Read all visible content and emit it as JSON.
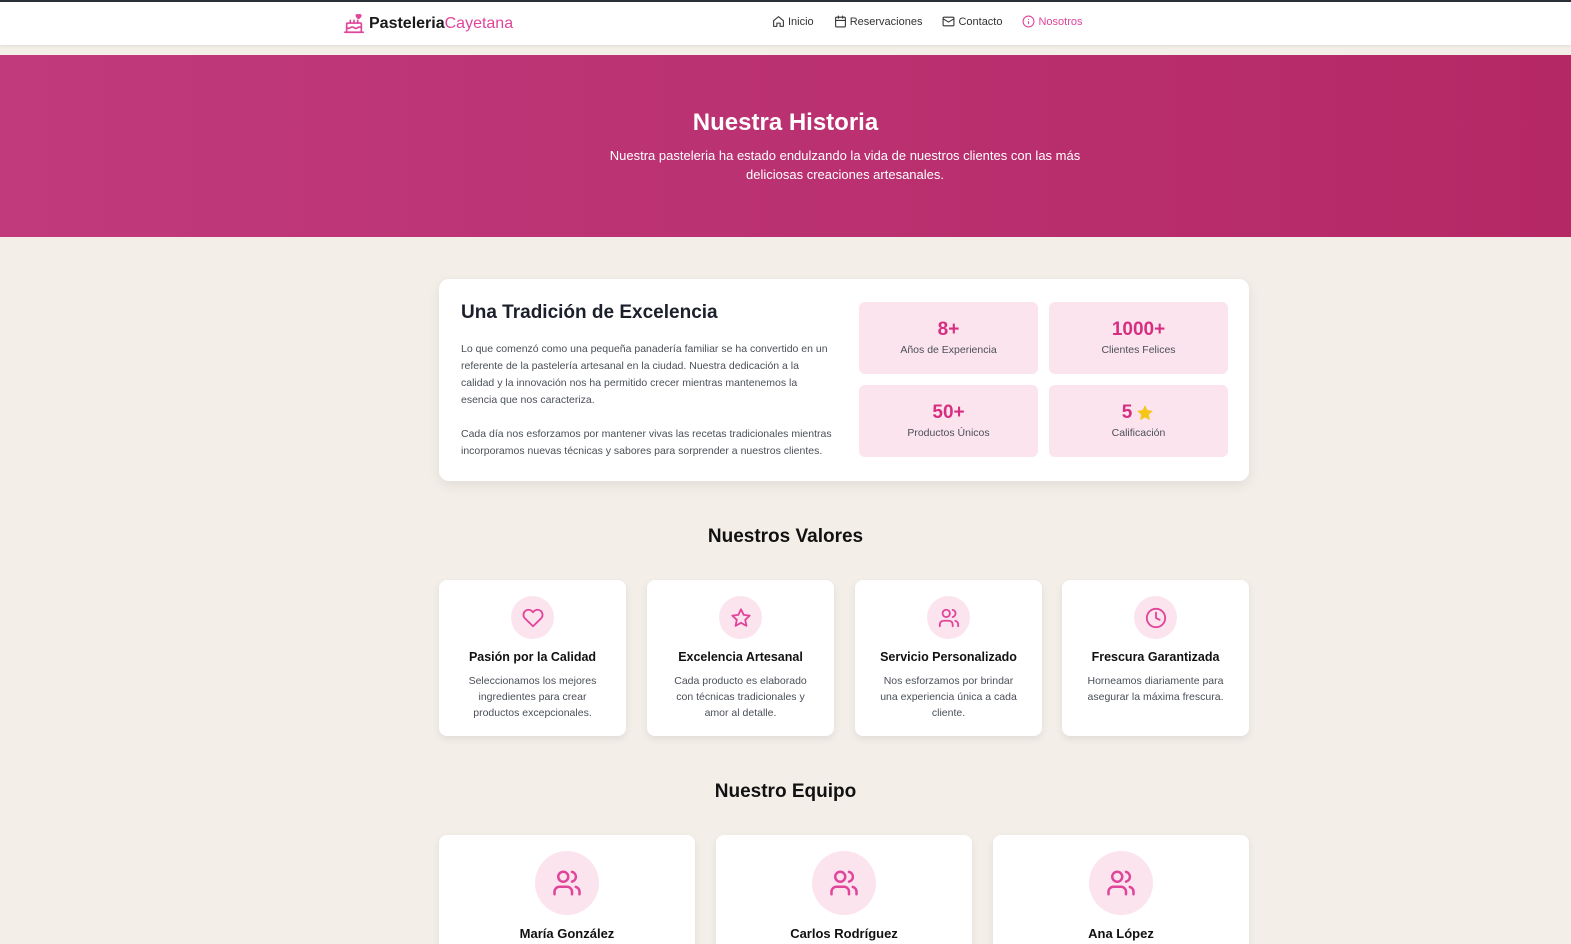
{
  "brand": {
    "name_bold": "Pasteleria",
    "name_light": "Cayetana",
    "logo_icon": "cake-icon"
  },
  "nav": {
    "items": [
      {
        "label": "Inicio",
        "icon": "home-icon",
        "active": false
      },
      {
        "label": "Reservaciones",
        "icon": "calendar-icon",
        "active": false
      },
      {
        "label": "Contacto",
        "icon": "mail-icon",
        "active": false
      },
      {
        "label": "Nosotros",
        "icon": "info-icon",
        "active": true
      }
    ]
  },
  "hero": {
    "title": "Nuestra Historia",
    "subtitle": "Nuestra pasteleria ha estado endulzando la vida de nuestros clientes con las más deliciosas creaciones artesanales."
  },
  "story": {
    "title": "Una Tradición de Excelencia",
    "paragraph1": "Lo que comenzó como una pequeña panadería familiar se ha convertido en un referente de la pastelería artesanal en la ciudad. Nuestra dedicación a la calidad y la innovación nos ha permitido crecer mientras mantenemos la esencia que nos caracteriza.",
    "paragraph2": "Cada día nos esforzamos por mantener vivas las recetas tradicionales mientras incorporamos nuevas técnicas y sabores para sorprender a nuestros clientes.",
    "stats": [
      {
        "value": "8+",
        "label": "Años de Experiencia"
      },
      {
        "value": "1000+",
        "label": "Clientes Felices"
      },
      {
        "value": "50+",
        "label": "Productos Únicos"
      },
      {
        "value": "5",
        "label": "Calificación",
        "icon": "star-icon"
      }
    ]
  },
  "values": {
    "title": "Nuestros Valores",
    "items": [
      {
        "icon": "heart-icon",
        "title": "Pasión por la Calidad",
        "description": "Seleccionamos los mejores ingredientes para crear productos excepcionales."
      },
      {
        "icon": "star-outline-icon",
        "title": "Excelencia Artesanal",
        "description": "Cada producto es elaborado con técnicas tradicionales y amor al detalle."
      },
      {
        "icon": "users-icon",
        "title": "Servicio Personalizado",
        "description": "Nos esforzamos por brindar una experiencia única a cada cliente."
      },
      {
        "icon": "clock-icon",
        "title": "Frescura Garantizada",
        "description": "Horneamos diariamente para asegurar la máxima frescura."
      }
    ]
  },
  "team": {
    "title": "Nuestro Equipo",
    "members": [
      {
        "name": "María González",
        "icon": "users-icon"
      },
      {
        "name": "Carlos Rodríguez",
        "icon": "users-icon"
      },
      {
        "name": "Ana López",
        "icon": "users-icon"
      }
    ]
  },
  "colors": {
    "accent": "#e0459a",
    "hero_start": "#c03a7c",
    "hero_end": "#b52866",
    "stat_bg": "#fce4ef",
    "page_bg": "#f3eee8",
    "star": "#f5c518"
  }
}
